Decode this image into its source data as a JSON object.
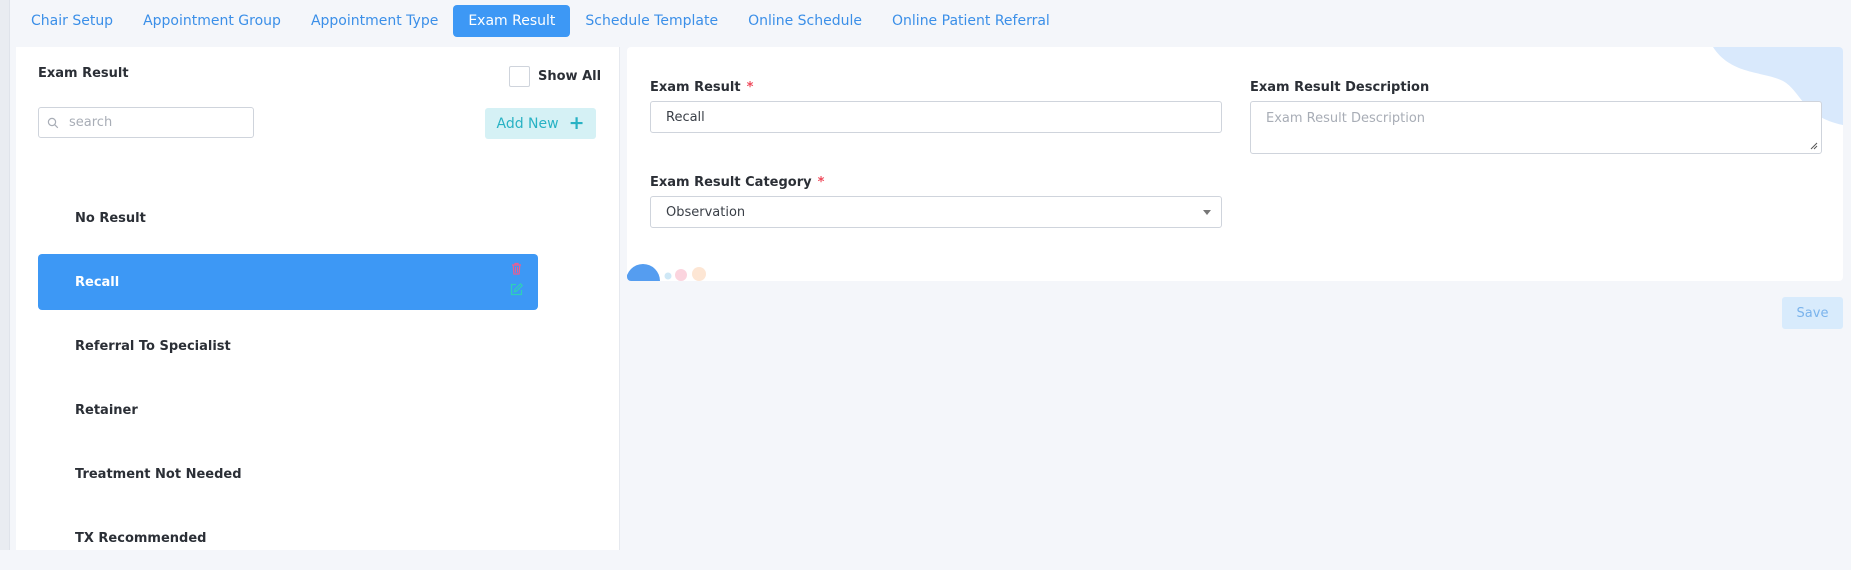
{
  "tabs": [
    {
      "label": "Chair Setup"
    },
    {
      "label": "Appointment Group"
    },
    {
      "label": "Appointment Type"
    },
    {
      "label": "Exam Result",
      "active": true
    },
    {
      "label": "Schedule Template"
    },
    {
      "label": "Online Schedule"
    },
    {
      "label": "Online Patient Referral"
    }
  ],
  "left_panel": {
    "title": "Exam Result",
    "show_all_label": "Show All",
    "show_all_checked": false,
    "search_placeholder": "search",
    "add_new_label": "Add New",
    "add_new_icon": "+",
    "items": [
      {
        "label": "No Result"
      },
      {
        "label": "Recall",
        "selected": true
      },
      {
        "label": "Referral To Specialist"
      },
      {
        "label": "Retainer"
      },
      {
        "label": "Treatment Not Needed"
      },
      {
        "label": "TX Recommended"
      }
    ]
  },
  "form": {
    "exam_result_label": "Exam Result",
    "exam_result_required": "*",
    "exam_result_value": "Recall",
    "description_label": "Exam Result Description",
    "description_placeholder": "Exam Result Description",
    "category_label": "Exam Result Category",
    "category_required": "*",
    "category_value": "Observation"
  },
  "save_label": "Save",
  "colors": {
    "accent": "#3d98f5",
    "tab_text": "#3b8fe8",
    "add_new_bg": "#d5f1f5",
    "add_new_text": "#28b2c4",
    "required": "#ef4a5b",
    "delete_icon": "#f05b8f",
    "edit_icon": "#2ed0b8"
  }
}
